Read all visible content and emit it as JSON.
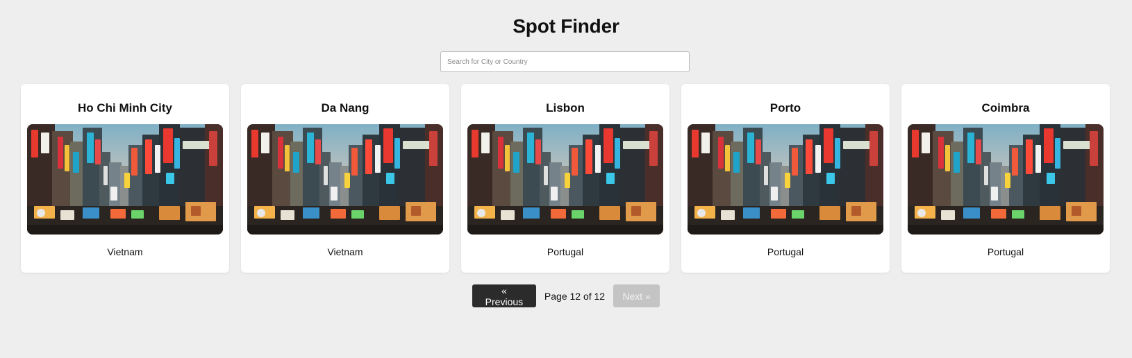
{
  "header": {
    "title": "Spot Finder"
  },
  "search": {
    "placeholder": "Search for City or Country",
    "value": ""
  },
  "cards": [
    {
      "city": "Ho Chi Minh City",
      "country": "Vietnam"
    },
    {
      "city": "Da Nang",
      "country": "Vietnam"
    },
    {
      "city": "Lisbon",
      "country": "Portugal"
    },
    {
      "city": "Porto",
      "country": "Portugal"
    },
    {
      "city": "Coimbra",
      "country": "Portugal"
    }
  ],
  "pagination": {
    "prev_label": "« Previous",
    "page_info": "Page 12 of 12",
    "next_label": "Next »",
    "current_page": 12,
    "total_pages": 12,
    "next_disabled": true
  },
  "colors": {
    "background": "#eeeeee",
    "card": "#ffffff",
    "prev_button": "#2b2b2b",
    "next_button_disabled": "#c4c4c4"
  }
}
